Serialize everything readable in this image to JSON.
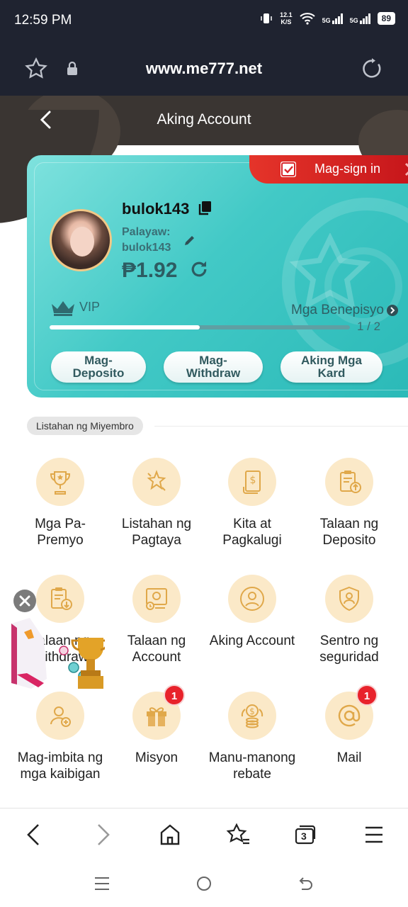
{
  "status_bar": {
    "time": "12:59 PM",
    "net_speed_value": "12.1",
    "net_speed_unit": "K/S",
    "signal1": "5G",
    "signal2": "5G",
    "battery": "89"
  },
  "browser": {
    "url": "www.me777.net"
  },
  "header": {
    "title": "Aking Account"
  },
  "card": {
    "sign_in_label": "Mag-sign in",
    "username": "bulok143",
    "nickname_label": "Palayaw:",
    "nickname_value": "bulok143",
    "balance": "₱1.92",
    "vip_label": "VIP",
    "benefits_label": "Mga Benepisyo",
    "progress_text": "1 / 2",
    "progress_value": 0.5,
    "buttons": [
      {
        "label": "Mag-Deposito"
      },
      {
        "label": "Mag-Withdraw"
      },
      {
        "label": "Aking Mga Kard"
      }
    ]
  },
  "member_section": {
    "title": "Listahan ng Miyembro",
    "items": [
      {
        "label": "Mga Pa-Premyo",
        "icon": "trophy-icon"
      },
      {
        "label": "Listahan ng Pagtaya",
        "icon": "stars-icon"
      },
      {
        "label": "Kita at Pagkalugi",
        "icon": "dollar-doc-icon"
      },
      {
        "label": "Talaan ng Deposito",
        "icon": "clipboard-up-icon"
      },
      {
        "label": "Talaan ng Withdraw",
        "icon": "clipboard-down-icon"
      },
      {
        "label": "Talaan ng Account",
        "icon": "account-record-icon"
      },
      {
        "label": "Aking Account",
        "icon": "user-circle-icon"
      },
      {
        "label": "Sentro ng seguridad",
        "icon": "shield-user-icon"
      },
      {
        "label": "Mag-imbita ng mga kaibigan",
        "icon": "add-user-icon"
      },
      {
        "label": "Misyon",
        "icon": "gift-icon",
        "badge": "1"
      },
      {
        "label": "Manu-manong rebate",
        "icon": "coins-icon"
      },
      {
        "label": "Mail",
        "icon": "at-sign-icon",
        "badge": "1"
      }
    ]
  },
  "bottom_nav": {
    "tabs_count": "3"
  },
  "colors": {
    "card_accent": "#42c9c6",
    "sign_in_red": "#d9262b",
    "icon_bg": "#fbe9c8",
    "icon_stroke": "#e0a84a",
    "badge": "#e8222b"
  }
}
